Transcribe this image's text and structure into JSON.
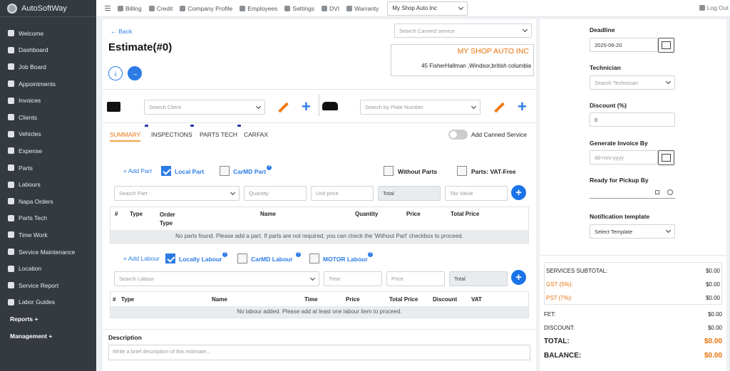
{
  "app": {
    "brand": "AutoSoftWay"
  },
  "sidebar": {
    "items": [
      {
        "label": "Welcome",
        "icon": "palette-icon"
      },
      {
        "label": "Dashboard",
        "icon": "gauge-icon"
      },
      {
        "label": "Job Board",
        "icon": "clipboard-icon"
      },
      {
        "label": "Appointments",
        "icon": "calendar-icon"
      },
      {
        "label": "Invoices",
        "icon": "file-icon"
      },
      {
        "label": "Clients",
        "icon": "users-icon"
      },
      {
        "label": "Vehicles",
        "icon": "car-icon"
      },
      {
        "label": "Expense",
        "icon": "money-icon"
      },
      {
        "label": "Parts",
        "icon": "wrench-icon"
      },
      {
        "label": "Labours",
        "icon": "bag-icon"
      },
      {
        "label": "Napa Orders",
        "icon": "wrench-icon"
      },
      {
        "label": "Parts Tech",
        "icon": "shuffle-icon"
      },
      {
        "label": "Time Work",
        "icon": "clock-icon"
      },
      {
        "label": "Service Maintenance",
        "icon": "tools-icon"
      },
      {
        "label": "Location",
        "icon": "map-icon"
      },
      {
        "label": "Service Report",
        "icon": "wrench-icon"
      },
      {
        "label": "Labor Guides",
        "icon": "tools-icon"
      }
    ],
    "sections": [
      "Reports +",
      "Management +"
    ]
  },
  "topbar": {
    "links": [
      "Billing",
      "Credit",
      "Company Profile",
      "Employees",
      "Settings",
      "DVI",
      "Warranty"
    ],
    "shop_select": "My Shop Auto Inc",
    "logout": "Log Out"
  },
  "main": {
    "back": "Back",
    "title": "Estimate(#0)",
    "canned_search": "Search Canned service",
    "shop_name": "MY SHOP AUTO INC",
    "shop_address": "45 FisherHallman ,Windsor,british columbia",
    "client_search": "Search Client",
    "plate_search": "Search by Plate Number",
    "tabs": [
      "SUMMARY",
      "INSPECTIONS",
      "PARTS TECH",
      "CARFAX"
    ],
    "add_canned": "Add Canned Service",
    "parts": {
      "add": "+ Add Part",
      "local": "Local Part",
      "carmd": "CarMD Part",
      "without": "Without Parts",
      "vat_free": "Parts: VAT-Free",
      "search": "Search Part",
      "quantity": "Quantity",
      "unit_price": "Unit price",
      "total": "Total",
      "tax": "Tax Value",
      "headers": [
        "#",
        "Type",
        "Order Type",
        "Name",
        "Quantity",
        "Price",
        "Total Price"
      ],
      "empty": "No parts found. Please add a part. If parts are not required, you can check the 'Without Part' checkbox to proceed."
    },
    "labour": {
      "add": "+ Add Labour",
      "local": "Locally Labour",
      "carmd": "CarMD Labour",
      "motor": "MOTOR Labour",
      "search": "Search Labour",
      "time": "Time",
      "price": "Price",
      "total": "Total",
      "headers": [
        "#",
        "Type",
        "Name",
        "Time",
        "Price",
        "Total Price",
        "Discount",
        "VAT"
      ],
      "empty": "No labour added. Please add at least one labour item to proceed."
    },
    "description_label": "Description",
    "description_placeholder": "Write a brief description of this estimate..."
  },
  "right": {
    "deadline_label": "Deadline",
    "deadline_value": "2025-06-20",
    "technician_label": "Technician",
    "technician_placeholder": "Search Technician",
    "discount_label": "Discount (%)",
    "discount_value": "0",
    "invoice_by_label": "Generate Invoice By",
    "invoice_by_placeholder": "dd-mm-yyyy",
    "pickup_label": "Ready for Pickup By",
    "notification_label": "Notification template",
    "notification_placeholder": "Select Template",
    "totals": {
      "services_subtotal": {
        "label": "SERVICES SUBTOTAL:",
        "value": "$0.00"
      },
      "gst": {
        "label": "GST (5%):",
        "value": "$0.00"
      },
      "pst": {
        "label": "PST (7%):",
        "value": "$0.00"
      },
      "fet": {
        "label": "FET:",
        "value": "$0.00"
      },
      "discount": {
        "label": "DISCOUNT:",
        "value": "$0.00"
      },
      "total": {
        "label": "TOTAL:",
        "value": "$0.00"
      },
      "balance": {
        "label": "BALANCE:",
        "value": "$0.00"
      }
    }
  },
  "colors": {
    "accent": "#2c7be5",
    "orange": "#e8710a",
    "sidebar": "#343a40"
  }
}
